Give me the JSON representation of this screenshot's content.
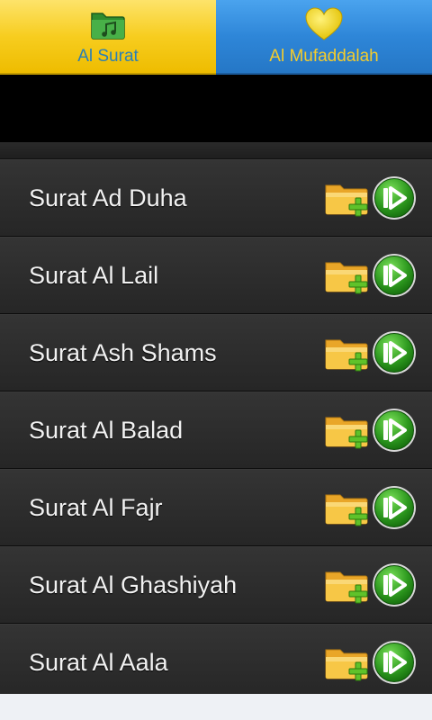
{
  "tabs": {
    "surat": {
      "label": "Al Surat",
      "icon": "folder-music-icon",
      "bg": "#f7cd1f",
      "text": "#2a7fb6"
    },
    "mufaddalah": {
      "label": "Al Mufaddalah",
      "icon": "heart-icon",
      "bg": "#2e86d8",
      "text": "#f4cc2c"
    }
  },
  "list": {
    "items": [
      {
        "title": "Surat Ad Duha"
      },
      {
        "title": "Surat Al Lail"
      },
      {
        "title": "Surat Ash Shams"
      },
      {
        "title": "Surat Al Balad"
      },
      {
        "title": "Surat Al Fajr"
      },
      {
        "title": "Surat Al Ghashiyah"
      },
      {
        "title": "Surat Al Aala"
      }
    ],
    "add_icon": "folder-add-icon",
    "play_icon": "play-icon"
  }
}
